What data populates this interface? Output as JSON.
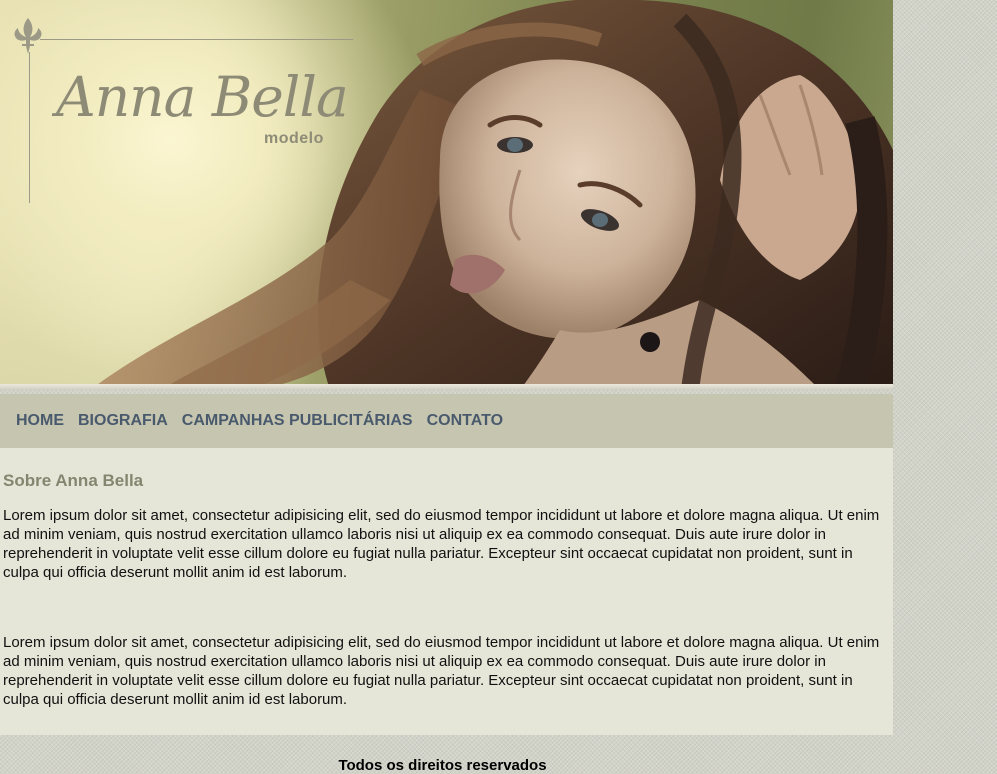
{
  "colors": {
    "page_background": "#d2d3c8",
    "nav_background": "#c6c6b0",
    "nav_link": "#4a5a6d",
    "content_background": "#e5e6d8",
    "heading": "#86856f",
    "logo": "#8d8b76"
  },
  "header": {
    "logo_name": "Anna Bella",
    "logo_subtitle": "modelo",
    "logo_icon": "fleur-de-lis-icon",
    "banner_image": "portrait-photo"
  },
  "nav": {
    "items": [
      {
        "label": "HOME"
      },
      {
        "label": "BIOGRAFIA"
      },
      {
        "label": "CAMPANHAS PUBLICITÁRIAS"
      },
      {
        "label": "CONTATO"
      }
    ]
  },
  "main": {
    "title": "Sobre Anna Bella",
    "paragraphs": [
      "Lorem ipsum dolor sit amet, consectetur adipisicing elit, sed do eiusmod tempor incididunt ut labore et dolore magna aliqua. Ut enim ad minim veniam, quis nostrud exercitation ullamco laboris nisi ut aliquip ex ea commodo consequat. Duis aute irure dolor in reprehenderit in voluptate velit esse cillum dolore eu fugiat nulla pariatur. Excepteur sint occaecat cupidatat non proident, sunt in culpa qui officia deserunt mollit anim id est laborum.",
      "Lorem ipsum dolor sit amet, consectetur adipisicing elit, sed do eiusmod tempor incididunt ut labore et dolore magna aliqua. Ut enim ad minim veniam, quis nostrud exercitation ullamco laboris nisi ut aliquip ex ea commodo consequat. Duis aute irure dolor in reprehenderit in voluptate velit esse cillum dolore eu fugiat nulla pariatur. Excepteur sint occaecat cupidatat non proident, sunt in culpa qui officia deserunt mollit anim id est laborum."
    ]
  },
  "footer": {
    "text": "Todos os direitos reservados"
  }
}
